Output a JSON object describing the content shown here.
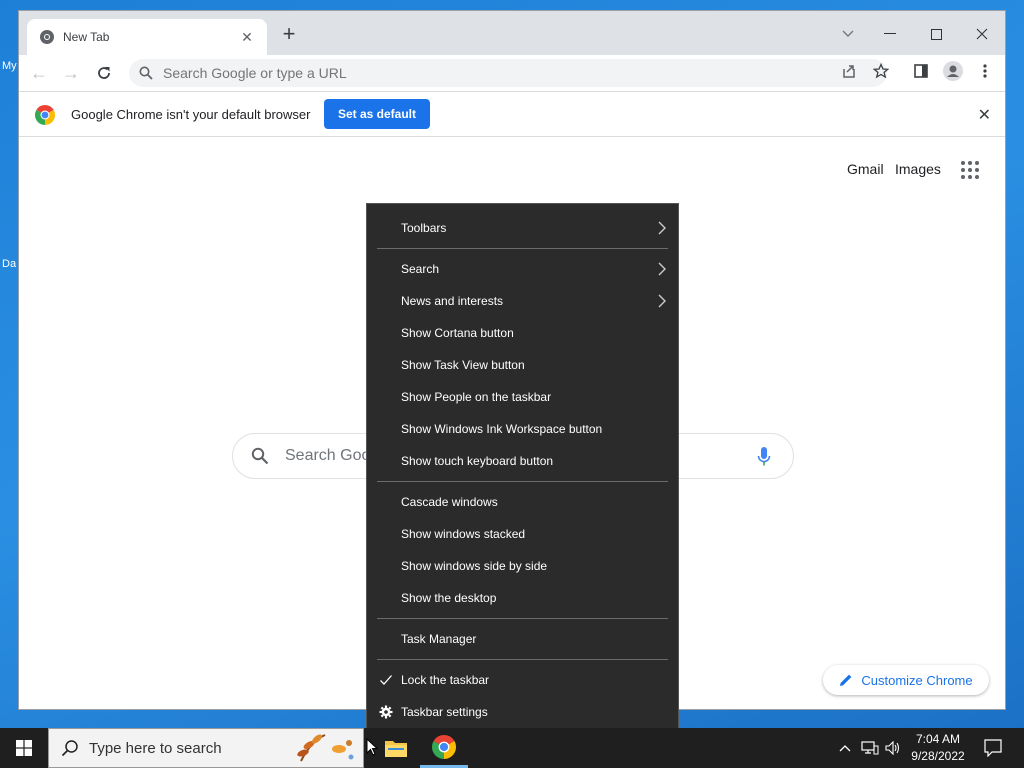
{
  "desktop": {
    "fragment_1": "My",
    "fragment_2": "Da"
  },
  "browser": {
    "tab": {
      "title": "New Tab"
    },
    "omnibox": {
      "placeholder": "Search Google or type a URL"
    },
    "infobar": {
      "message": "Google Chrome isn't your default browser",
      "button": "Set as default"
    },
    "ntp": {
      "gmail": "Gmail",
      "images": "Images",
      "search_placeholder": "Search Goog",
      "customize": "Customize Chrome"
    }
  },
  "context_menu": {
    "items": [
      {
        "label": "Toolbars",
        "submenu": true
      },
      {
        "label": "Search",
        "submenu": true
      },
      {
        "label": "News and interests",
        "submenu": true
      },
      {
        "label": "Show Cortana button"
      },
      {
        "label": "Show Task View button"
      },
      {
        "label": "Show People on the taskbar"
      },
      {
        "label": "Show Windows Ink Workspace button"
      },
      {
        "label": "Show touch keyboard button"
      },
      {
        "label": "Cascade windows"
      },
      {
        "label": "Show windows stacked"
      },
      {
        "label": "Show windows side by side"
      },
      {
        "label": "Show the desktop"
      },
      {
        "label": "Task Manager"
      },
      {
        "label": "Lock the taskbar",
        "icon": "check-icon"
      },
      {
        "label": "Taskbar settings",
        "icon": "gear-icon"
      }
    ]
  },
  "taskbar": {
    "search_placeholder": "Type here to search",
    "time": "7:04 AM",
    "date": "9/28/2022"
  },
  "colors": {
    "accent": "#1a73e8",
    "menu_bg": "#2b2b2b",
    "taskbar_bg": "#1f1f1f"
  }
}
